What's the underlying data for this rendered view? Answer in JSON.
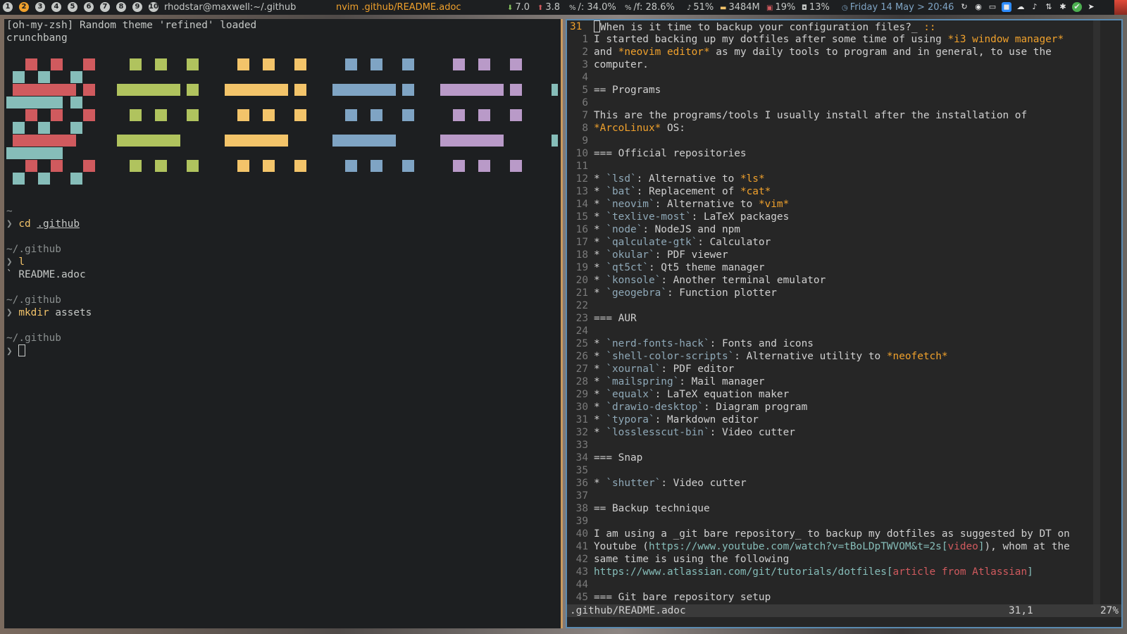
{
  "topbar": {
    "workspaces": [
      "1",
      "2",
      "3",
      "4",
      "5",
      "6",
      "7",
      "8",
      "9",
      "10"
    ],
    "active_workspace": "2",
    "title": "rhodstar@maxwell:~/.github",
    "window": "nvim .github/README.adoc",
    "stats": [
      {
        "icon": "download-icon",
        "glyph": "⬇",
        "label": "7.0",
        "color": "#86c35e"
      },
      {
        "icon": "upload-icon",
        "glyph": "⬆",
        "label": "3.8",
        "color": "#d05a5e"
      },
      {
        "icon": "disk-root-icon",
        "glyph": "%",
        "label": "/: 34.0%",
        "color": "#c5c8c6"
      },
      {
        "icon": "disk-f-icon",
        "glyph": "%",
        "label": "/f: 28.6%",
        "color": "#c5c8c6"
      },
      {
        "icon": "volume-icon",
        "glyph": "♪",
        "label": "51%",
        "color": "#c5c8c6"
      },
      {
        "icon": "memory-icon",
        "glyph": "▬",
        "label": "3484M",
        "color": "#f3c46a"
      },
      {
        "icon": "cpu-icon",
        "glyph": "▣",
        "label": "19%",
        "color": "#d05a5e"
      },
      {
        "icon": "cpu-temp-icon",
        "glyph": "◘",
        "label": "13%",
        "color": "#c5c8c6"
      },
      {
        "icon": "clock-icon",
        "glyph": "◷",
        "label": "Friday 14 May > 20:46",
        "color": "#7fa4c4"
      }
    ],
    "tray": [
      "sync-icon",
      "discord-icon",
      "display-icon",
      "zoom-icon",
      "cloud-icon",
      "volume-icon",
      "network-icon",
      "bluetooth-icon",
      "check-icon",
      "send-icon"
    ]
  },
  "terminal": {
    "lines": [
      "[oh-my-zsh] Random theme 'refined' loaded",
      "crunchbang"
    ],
    "sessions": [
      {
        "dir": "~",
        "prompt": "❯",
        "cmd": "cd",
        "arg": ".github",
        "output": ""
      },
      {
        "dir": "~/.github",
        "prompt": "❯",
        "cmd": "l",
        "arg": "",
        "output": "` README.adoc"
      },
      {
        "dir": "~/.github",
        "prompt": "❯",
        "cmd": "mkdir",
        "arg": "assets",
        "output": ""
      },
      {
        "dir": "~/.github",
        "prompt": "❯",
        "cmd": "",
        "arg": "",
        "output": ""
      }
    ]
  },
  "editor": {
    "current_line_number": "31",
    "lines": [
      {
        "n": "31",
        "t": "When is it time to backup your configuration files?_ ::"
      },
      {
        "n": "1",
        "t": "I started backing up my dotfiles after some time of using *i3 window manager*"
      },
      {
        "n": "2",
        "t": "and *neovim editor* as my daily tools to program and in general, to use the"
      },
      {
        "n": "3",
        "t": "computer."
      },
      {
        "n": "4",
        "t": ""
      },
      {
        "n": "5",
        "t": "== Programs"
      },
      {
        "n": "6",
        "t": ""
      },
      {
        "n": "7",
        "t": "This are the programs/tools I usually install after the installation of"
      },
      {
        "n": "8",
        "t": "*ArcoLinux* OS:"
      },
      {
        "n": "9",
        "t": ""
      },
      {
        "n": "10",
        "t": "=== Official repositories"
      },
      {
        "n": "11",
        "t": ""
      },
      {
        "n": "12",
        "t": "* `lsd`: Alternative to *ls*"
      },
      {
        "n": "13",
        "t": "* `bat`: Replacement of *cat*"
      },
      {
        "n": "14",
        "t": "* `neovim`: Alternative to *vim*"
      },
      {
        "n": "15",
        "t": "* `texlive-most`: LaTeX packages"
      },
      {
        "n": "16",
        "t": "* `node`: NodeJS and npm"
      },
      {
        "n": "17",
        "t": "* `qalculate-gtk`: Calculator"
      },
      {
        "n": "18",
        "t": "* `okular`: PDF viewer"
      },
      {
        "n": "19",
        "t": "* `qt5ct`: Qt5 theme manager"
      },
      {
        "n": "20",
        "t": "* `konsole`: Another terminal emulator"
      },
      {
        "n": "21",
        "t": "* `geogebra`: Function plotter"
      },
      {
        "n": "22",
        "t": ""
      },
      {
        "n": "23",
        "t": "=== AUR"
      },
      {
        "n": "24",
        "t": ""
      },
      {
        "n": "25",
        "t": "* `nerd-fonts-hack`: Fonts and icons"
      },
      {
        "n": "26",
        "t": "* `shell-color-scripts`: Alternative utility to *neofetch*"
      },
      {
        "n": "27",
        "t": "* `xournal`: PDF editor"
      },
      {
        "n": "28",
        "t": "* `mailspring`: Mail manager"
      },
      {
        "n": "29",
        "t": "* `equalx`: LaTeX equation maker"
      },
      {
        "n": "30",
        "t": "* `drawio-desktop`: Diagram program"
      },
      {
        "n": "31",
        "t": "* `typora`: Markdown editor"
      },
      {
        "n": "32",
        "t": "* `losslesscut-bin`: Video cutter"
      },
      {
        "n": "33",
        "t": ""
      },
      {
        "n": "34",
        "t": "=== Snap"
      },
      {
        "n": "35",
        "t": ""
      },
      {
        "n": "36",
        "t": "* `shutter`: Video cutter"
      },
      {
        "n": "37",
        "t": ""
      },
      {
        "n": "38",
        "t": "== Backup technique"
      },
      {
        "n": "39",
        "t": ""
      },
      {
        "n": "40",
        "t": "I am using a _git bare repository_ to backup my dotfiles as suggested by DT on"
      },
      {
        "n": "41",
        "t": "Youtube (https://www.youtube.com/watch?v=tBoLDpTWVOM&t=2s[video]), whom at the"
      },
      {
        "n": "42",
        "t": "same time is using the following"
      },
      {
        "n": "43",
        "t": "https://www.atlassian.com/git/tutorials/dotfiles[article from Atlassian]"
      },
      {
        "n": "44",
        "t": ""
      },
      {
        "n": "45",
        "t": "=== Git bare repository setup"
      }
    ],
    "status_file": ".github/README.adoc",
    "status_pos": "31,1",
    "status_pct": "27%"
  }
}
